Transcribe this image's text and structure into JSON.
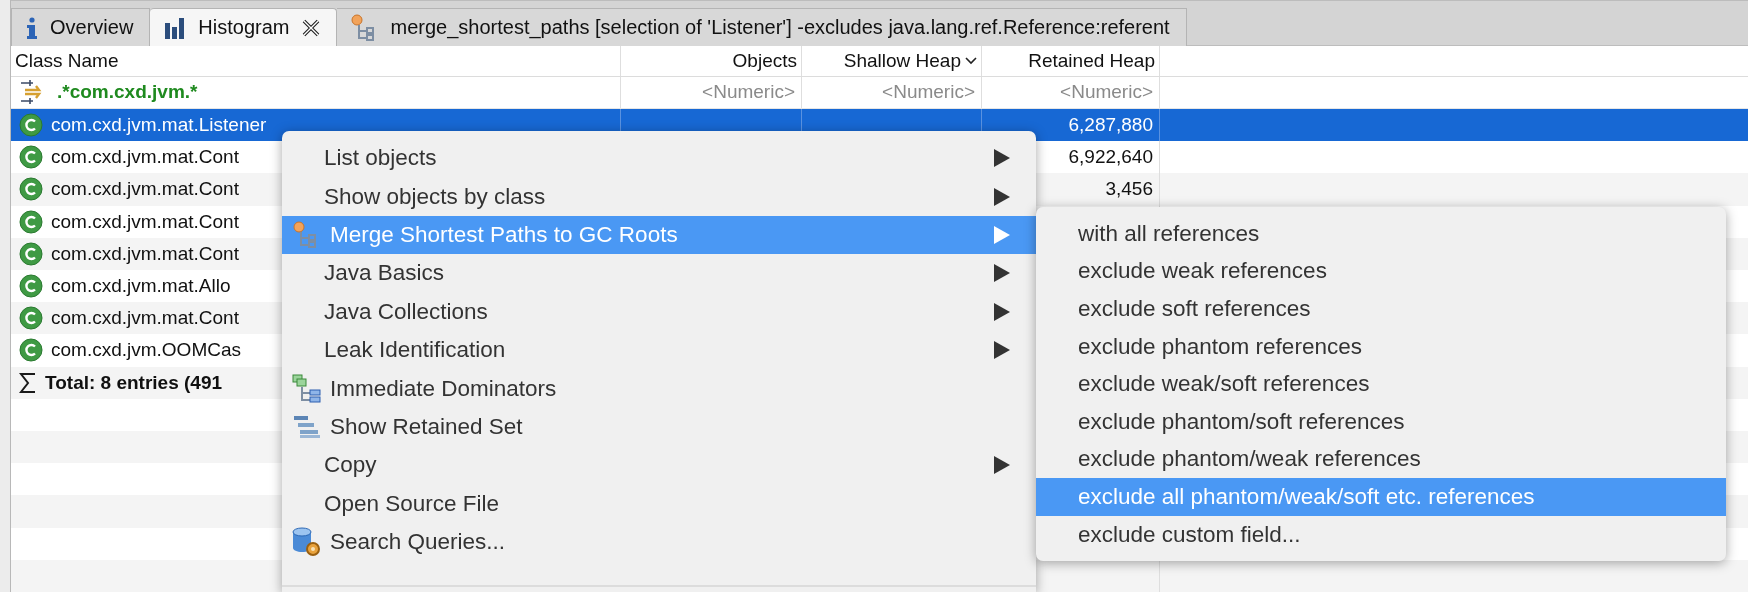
{
  "tabs": [
    {
      "label": "Overview",
      "kind": "info",
      "selected": false,
      "closable": false
    },
    {
      "label": "Histogram",
      "kind": "histogram",
      "selected": true,
      "closable": true
    },
    {
      "label": "merge_shortest_paths [selection of 'Listener'] -excludes java.lang.ref.Reference:referent",
      "kind": "paths",
      "selected": false,
      "closable": false
    }
  ],
  "table": {
    "columns": [
      {
        "label": "Class Name",
        "sorted": false
      },
      {
        "label": "Objects",
        "sorted": false
      },
      {
        "label": "Shallow Heap",
        "sorted": true
      },
      {
        "label": "Retained Heap",
        "sorted": false
      }
    ],
    "rows": [
      {
        "kind": "filter",
        "selected": false,
        "name": ".*com.cxd.jvm.*",
        "objects": "<Numeric>",
        "shallow_heap": "<Numeric>",
        "retained_heap": "<Numeric>"
      },
      {
        "kind": "class",
        "selected": true,
        "name": "com.cxd.jvm.mat.Listener",
        "retained_heap": "6,287,880"
      },
      {
        "kind": "class",
        "selected": false,
        "name": "com.cxd.jvm.mat.Cont",
        "retained_heap": "6,922,640"
      },
      {
        "kind": "class",
        "selected": false,
        "name": "com.cxd.jvm.mat.Cont",
        "retained_heap": "3,456"
      },
      {
        "kind": "class",
        "selected": false,
        "name": "com.cxd.jvm.mat.Cont"
      },
      {
        "kind": "class",
        "selected": false,
        "name": "com.cxd.jvm.mat.Cont"
      },
      {
        "kind": "class",
        "selected": false,
        "name": "com.cxd.jvm.mat.Allo"
      },
      {
        "kind": "class",
        "selected": false,
        "name": "com.cxd.jvm.mat.Cont"
      },
      {
        "kind": "class",
        "selected": false,
        "name": "com.cxd.jvm.OOMCas"
      },
      {
        "kind": "total",
        "selected": false,
        "name": "Total: 8 entries (491"
      }
    ]
  },
  "context_menu": {
    "items": [
      {
        "label": "List objects",
        "kind": "text",
        "has_submenu": true,
        "selected": false
      },
      {
        "label": "Show objects by class",
        "kind": "text",
        "has_submenu": true,
        "selected": false
      },
      {
        "label": "Merge Shortest Paths to GC Roots",
        "kind": "paths",
        "has_submenu": true,
        "selected": true
      },
      {
        "label": "Java Basics",
        "kind": "text",
        "has_submenu": true,
        "selected": false
      },
      {
        "label": "Java Collections",
        "kind": "text",
        "has_submenu": true,
        "selected": false
      },
      {
        "label": "Leak Identification",
        "kind": "text",
        "has_submenu": true,
        "selected": false
      },
      {
        "label": "Immediate Dominators",
        "kind": "dominators",
        "has_submenu": false,
        "selected": false
      },
      {
        "label": "Show Retained Set",
        "kind": "retained",
        "has_submenu": false,
        "selected": false
      },
      {
        "label": "Copy",
        "kind": "text",
        "has_submenu": true,
        "selected": false
      },
      {
        "label": "Open Source File",
        "kind": "text",
        "has_submenu": false,
        "selected": false
      },
      {
        "label": "Search Queries...",
        "kind": "queries",
        "has_submenu": false,
        "selected": false
      }
    ]
  },
  "submenu": {
    "items": [
      {
        "label": "with all references",
        "selected": false
      },
      {
        "label": "exclude weak references",
        "selected": false
      },
      {
        "label": "exclude soft references",
        "selected": false
      },
      {
        "label": "exclude phantom references",
        "selected": false
      },
      {
        "label": "exclude weak/soft references",
        "selected": false
      },
      {
        "label": "exclude phantom/soft references",
        "selected": false
      },
      {
        "label": "exclude phantom/weak references",
        "selected": false
      },
      {
        "label": "exclude all phantom/weak/soft etc. references",
        "selected": true
      },
      {
        "label": "exclude custom field...",
        "selected": false
      }
    ]
  }
}
